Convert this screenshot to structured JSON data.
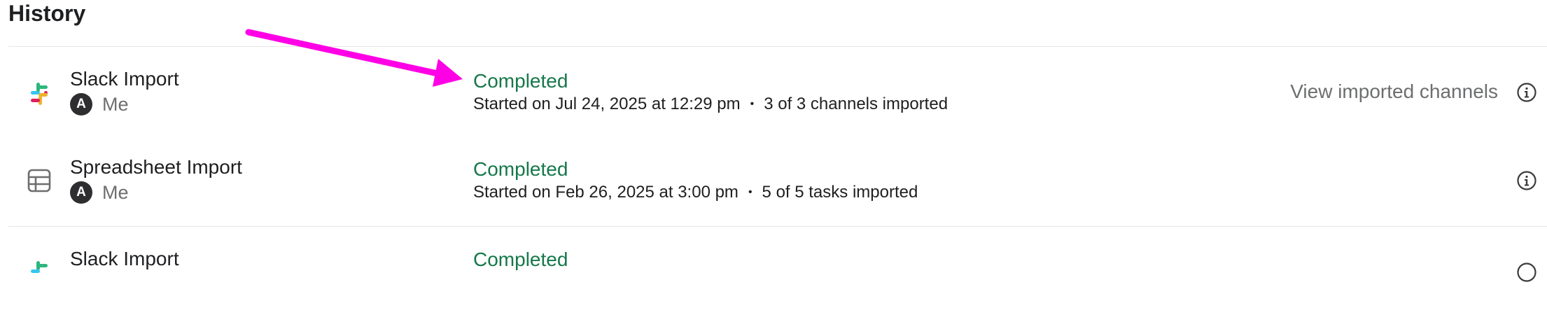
{
  "history": {
    "title": "History",
    "rows": [
      {
        "name": "Slack Import",
        "icon": "slack-icon",
        "owner_initial": "A",
        "owner_name": "Me",
        "status": "Completed",
        "started": "Started on Jul 24, 2025 at 12:29 pm",
        "separator": "•",
        "detail": "3 of 3 channels imported",
        "link_label": "View imported channels"
      },
      {
        "name": "Spreadsheet Import",
        "icon": "spreadsheet-icon",
        "owner_initial": "A",
        "owner_name": "Me",
        "status": "Completed",
        "started": "Started on Feb 26, 2025 at 3:00 pm",
        "separator": "•",
        "detail": "5 of 5 tasks imported"
      },
      {
        "name": "Slack Import",
        "icon": "slack-icon",
        "status": "Completed"
      }
    ]
  },
  "colors": {
    "status_green": "#16784a",
    "annotation_arrow": "#ff00e6"
  }
}
